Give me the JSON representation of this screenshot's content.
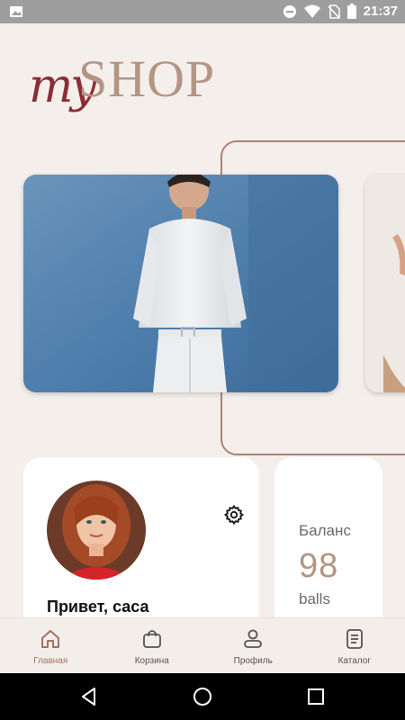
{
  "status_bar": {
    "time": "21:37",
    "icons": [
      "image-icon",
      "do-not-disturb-icon",
      "wifi-icon",
      "no-sim-icon",
      "battery-icon"
    ]
  },
  "logo": {
    "my": "my",
    "shop": "SHOP"
  },
  "carousel": {
    "items": [
      {
        "name": "man-in-white-outfit-banner"
      },
      {
        "name": "next-banner-partial"
      }
    ]
  },
  "profile": {
    "greeting": "Привет, саса"
  },
  "balance": {
    "label": "Баланс",
    "value": "98",
    "unit": "balls"
  },
  "bottom_nav": {
    "items": [
      {
        "label": "Главная",
        "icon": "home-icon",
        "active": true
      },
      {
        "label": "Корзина",
        "icon": "shopping-bag-icon",
        "active": false
      },
      {
        "label": "Профиль",
        "icon": "person-icon",
        "active": false
      },
      {
        "label": "Каталог",
        "icon": "catalog-icon",
        "active": false
      }
    ]
  },
  "colors": {
    "background": "#f5efec",
    "accent": "#b39584",
    "logo_my": "#8b2d35",
    "active_nav": "#a07462"
  }
}
